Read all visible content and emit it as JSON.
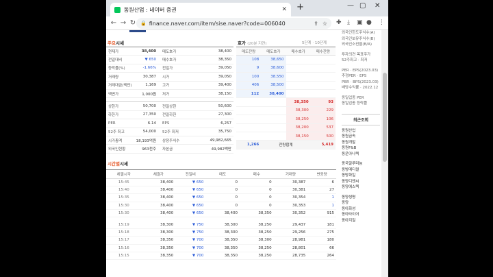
{
  "browser": {
    "tab_title": "동원산업 : 네이버 증권",
    "url": "finance.naver.com/item/sise.naver?code=006040"
  },
  "sections": {
    "quote": {
      "title_a": "주요",
      "title_b": "시세"
    },
    "orderbook": {
      "title": "호가",
      "note": "(20분 지연)",
      "links": "5단계 · 10단계"
    },
    "timeline": {
      "title_a": "시간별",
      "title_b": "시세"
    }
  },
  "quote_rows": [
    {
      "l1": "현재가",
      "v1": "38,400",
      "l2": "매도호가",
      "v2": "38,400"
    },
    {
      "l1": "전일대비",
      "v1": "▼ 650",
      "l2": "매수호가",
      "v2": "38,350"
    },
    {
      "l1": "등락률(%)",
      "v1": "-1.66%",
      "l2": "전일가",
      "v2": "39,050"
    },
    {
      "l1": "거래량",
      "v1": "30,387",
      "l2": "시가",
      "v2": "39,050"
    },
    {
      "l1": "거래대금(백만)",
      "v1": "1,169",
      "l2": "고가",
      "v2": "39,400"
    },
    {
      "l1": "액면가",
      "v1": "1,000원",
      "l2": "저가",
      "v2": "38,150"
    },
    {
      "l1": "",
      "v1": "",
      "l2": "",
      "v2": ""
    },
    {
      "l1": "상한가",
      "v1": "50,700",
      "l2": "전일상한",
      "v2": "50,600"
    },
    {
      "l1": "하한가",
      "v1": "27,350",
      "l2": "전일하한",
      "v2": "27,300"
    },
    {
      "l1": "PER",
      "v1": "6.14",
      "l2": "EPS",
      "v2": "6,257"
    },
    {
      "l1": "52주 최고",
      "v1": "54,000",
      "l2": "52주 최저",
      "v2": "35,750"
    },
    {
      "l1": "시가총액",
      "v1": "18,193억원",
      "l2": "상장주식수",
      "v2": "49,982,665"
    },
    {
      "l1": "외국인현황",
      "v1": "963천주",
      "l2": "자본금",
      "v2": "49,982백만"
    }
  ],
  "orderbook": {
    "headers": [
      "매도잔량",
      "매도호가",
      "매수호가",
      "매수잔량"
    ],
    "asks": [
      {
        "qty": "108",
        "price": "38,650"
      },
      {
        "qty": "9",
        "price": "38,600"
      },
      {
        "qty": "100",
        "price": "38,550"
      },
      {
        "qty": "406",
        "price": "38,500"
      },
      {
        "qty": "112",
        "price": "38,400"
      }
    ],
    "bids": [
      {
        "price": "38,350",
        "qty": "93"
      },
      {
        "price": "38,300",
        "qty": "229"
      },
      {
        "price": "38,250",
        "qty": "106"
      },
      {
        "price": "38,200",
        "qty": "537"
      },
      {
        "price": "38,150",
        "qty": "500"
      }
    ],
    "total": {
      "ask": "1,266",
      "label": "잔량합계",
      "bid": "5,419"
    }
  },
  "timeline": {
    "headers": [
      "체결시각",
      "체결가",
      "전일비",
      "매도",
      "매수",
      "거래량",
      "변동량"
    ],
    "rows": [
      [
        "15:45",
        "38,400",
        "650",
        "0",
        "0",
        "30,387",
        "6"
      ],
      [
        "15:40",
        "38,400",
        "650",
        "0",
        "0",
        "30,381",
        "27"
      ],
      [
        "15:35",
        "38,400",
        "650",
        "0",
        "0",
        "30,354",
        "1"
      ],
      [
        "15:30",
        "38,400",
        "650",
        "0",
        "0",
        "30,353",
        "1"
      ],
      [
        "15:30",
        "38,400",
        "650",
        "38,400",
        "38,350",
        "30,352",
        "915"
      ],
      [
        "15:19",
        "38,300",
        "750",
        "38,300",
        "38,250",
        "29,437",
        "181"
      ],
      [
        "15:18",
        "38,300",
        "750",
        "38,300",
        "38,250",
        "29,256",
        "275"
      ],
      [
        "15:17",
        "38,350",
        "700",
        "38,350",
        "38,300",
        "28,981",
        "180"
      ],
      [
        "15:16",
        "38,350",
        "700",
        "38,350",
        "38,250",
        "28,801",
        "66"
      ],
      [
        "15:15",
        "38,350",
        "700",
        "38,350",
        "38,250",
        "28,735",
        "264"
      ]
    ]
  },
  "sidebar": {
    "top": [
      "외국인한도주식수(A)",
      "외국인보유주식수(B)",
      "외국인소진율(B/A)"
    ],
    "mid": [
      "투자의견  목표주가",
      "52주최고 · 최저"
    ],
    "ratios": [
      "PER · EPS(2023.03)",
      "추정PER · EPS",
      "PBR · BPS(2023.03)",
      "배당수익률 · 2022.12"
    ],
    "peer": [
      "동일업종 PER",
      "동일업종 등락률"
    ],
    "recent_title": "최근조회",
    "list1": [
      "동원산업",
      "동원금속",
      "동원개발",
      "동원F&B",
      "동운아나텍"
    ],
    "list2": [
      "동국알루미늄",
      "동방메디컬",
      "동방화일",
      "동양디엔씨",
      "동양에스텍"
    ],
    "list3": [
      "동양생명",
      "동양",
      "동아화성",
      "동아타이어",
      "동아지질"
    ]
  }
}
